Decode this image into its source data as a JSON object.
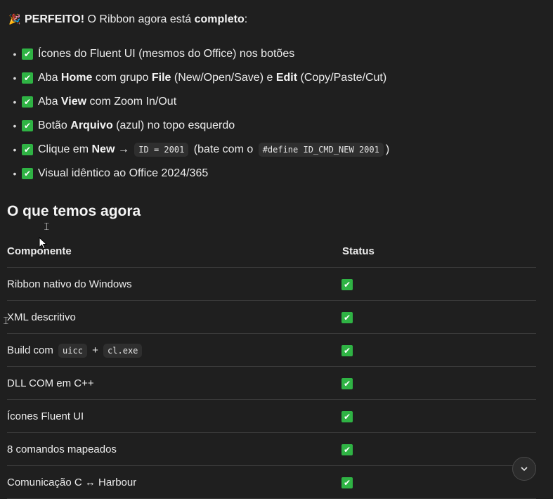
{
  "headline": {
    "emoji": "🎉",
    "strong1": "PERFEITO!",
    "text1": " O Ribbon agora está ",
    "strong2": "completo",
    "text2": ":"
  },
  "checklist": [
    {
      "icon": "✔",
      "parts": [
        {
          "t": "Ícones do Fluent UI (mesmos do Office) nos botões"
        }
      ]
    },
    {
      "icon": "✔",
      "parts": [
        {
          "t": "Aba "
        },
        {
          "b": "Home"
        },
        {
          "t": " com grupo "
        },
        {
          "b": "File"
        },
        {
          "t": " (New/Open/Save) e "
        },
        {
          "b": "Edit"
        },
        {
          "t": " (Copy/Paste/Cut)"
        }
      ]
    },
    {
      "icon": "✔",
      "parts": [
        {
          "t": "Aba "
        },
        {
          "b": "View"
        },
        {
          "t": " com Zoom In/Out"
        }
      ]
    },
    {
      "icon": "✔",
      "parts": [
        {
          "t": "Botão "
        },
        {
          "b": "Arquivo"
        },
        {
          "t": " (azul) no topo esquerdo"
        }
      ]
    },
    {
      "icon": "✔",
      "parts": [
        {
          "t": "Clique em "
        },
        {
          "b": "New"
        },
        {
          "t": " → "
        },
        {
          "c": "ID = 2001"
        },
        {
          "t": " (bate com o "
        },
        {
          "c": "#define ID_CMD_NEW 2001"
        },
        {
          "t": ")"
        }
      ]
    },
    {
      "icon": "✔",
      "parts": [
        {
          "t": "Visual idêntico ao Office 2024/365"
        }
      ]
    }
  ],
  "section_title": "O que temos agora",
  "table": {
    "headers": [
      "Componente",
      "Status"
    ],
    "rows": [
      {
        "parts": [
          {
            "t": "Ribbon nativo do Windows"
          }
        ],
        "status": "✔"
      },
      {
        "parts": [
          {
            "t": "XML descritivo"
          }
        ],
        "status": "✔"
      },
      {
        "parts": [
          {
            "t": "Build com "
          },
          {
            "c": "uicc"
          },
          {
            "t": " + "
          },
          {
            "c": "cl.exe"
          }
        ],
        "status": "✔"
      },
      {
        "parts": [
          {
            "t": "DLL COM em C++"
          }
        ],
        "status": "✔"
      },
      {
        "parts": [
          {
            "t": "Ícones Fluent UI"
          }
        ],
        "status": "✔"
      },
      {
        "parts": [
          {
            "t": "8 comandos mapeados"
          }
        ],
        "status": "✔"
      },
      {
        "parts": [
          {
            "t": "Comunicação C ↔ Harbour"
          }
        ],
        "status": "✔"
      }
    ]
  },
  "scroll_button_icon": "chevron-down",
  "colors": {
    "background": "#1f1f1f",
    "check_green": "#2fb344",
    "text": "#ececec"
  }
}
